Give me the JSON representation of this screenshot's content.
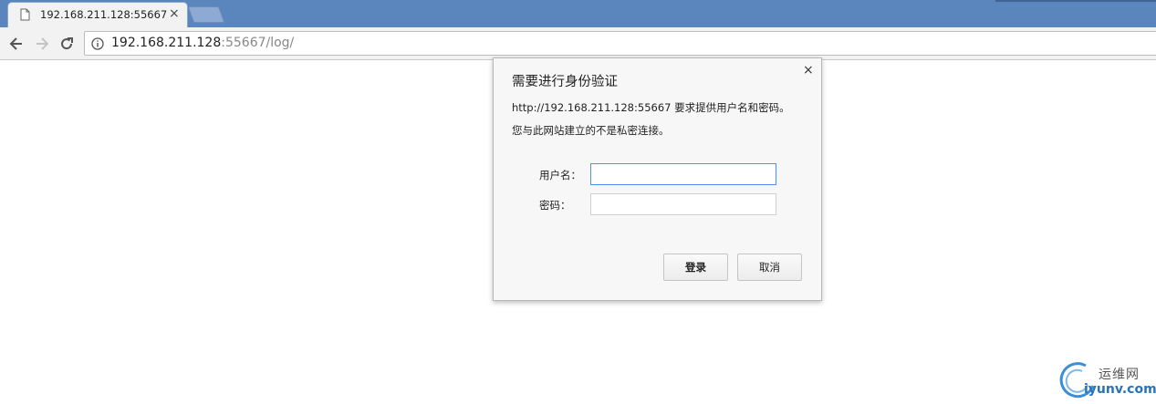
{
  "browser": {
    "tab": {
      "title": "192.168.211.128:55667",
      "close": "×"
    },
    "address": {
      "host": "192.168.211.128",
      "rest": ":55667/log/"
    }
  },
  "icons": {
    "back": "back-arrow-icon",
    "forward": "forward-arrow-icon",
    "reload": "reload-icon",
    "info": "info-icon",
    "page": "page-icon"
  },
  "dialog": {
    "title": "需要进行身份验证",
    "close": "×",
    "message_line1": "http://192.168.211.128:55667 要求提供用户名和密码。",
    "message_line2": "您与此网站建立的不是私密连接。",
    "username_label": "用户名：",
    "password_label": "密码：",
    "username_value": "",
    "password_value": "",
    "login_button": "登录",
    "cancel_button": "取消"
  },
  "watermark": {
    "cn": "运维网",
    "en": "iyunv.com"
  },
  "colors": {
    "tabstrip": "#5a86bd",
    "focus_border": "#4d90fe",
    "watermark_blue": "#2a73b8"
  }
}
